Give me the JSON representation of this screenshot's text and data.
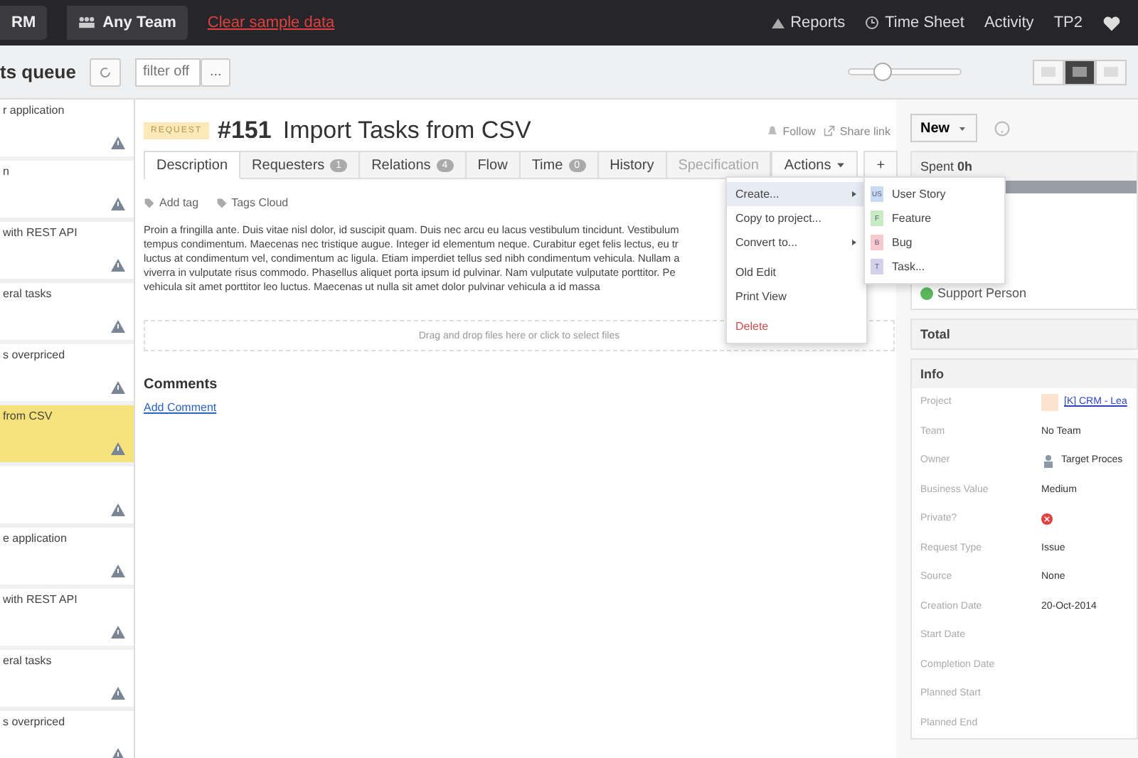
{
  "top_bar": {
    "project": "RM",
    "team": "Any Team",
    "clear_link": "Clear sample data",
    "nav": [
      {
        "kind": "reports",
        "label": "Reports"
      },
      {
        "kind": "clock",
        "label": "Time Sheet"
      },
      {
        "kind": "plain",
        "label": "Activity"
      },
      {
        "kind": "plain",
        "label": "TP2"
      }
    ]
  },
  "toolbar": {
    "title": "ts queue",
    "filter": {
      "placeholder": "filter off"
    },
    "more": "...",
    "zoom": {
      "level": 0.3
    },
    "views": [
      {
        "selected": false
      },
      {
        "selected": true
      },
      {
        "selected": false
      }
    ]
  },
  "queue": [
    {
      "title": "r application",
      "selected": false
    },
    {
      "title": "n",
      "selected": false
    },
    {
      "title": "with REST API",
      "selected": false
    },
    {
      "title": "eral tasks",
      "selected": false
    },
    {
      "title": "s overpriced",
      "selected": false
    },
    {
      "title": "from CSV",
      "selected": true
    },
    {
      "selected": false
    },
    {
      "title": "e application",
      "selected": false
    },
    {
      "title": "with REST API",
      "selected": false
    },
    {
      "title": "eral tasks",
      "selected": false
    },
    {
      "title": "s overpriced",
      "selected": false
    }
  ],
  "entity": {
    "type": "REQUEST",
    "id": "#151",
    "title": "Import Tasks from CSV",
    "follow": "Follow",
    "share": "Share link",
    "tabs": [
      {
        "label": "Description",
        "selected": true,
        "disabled": false
      },
      {
        "label": "Requesters",
        "count": "1",
        "selected": false,
        "disabled": false
      },
      {
        "label": "Relations",
        "count": "4",
        "selected": false,
        "disabled": false
      },
      {
        "label": "Flow",
        "selected": false,
        "disabled": false
      },
      {
        "label": "Time",
        "count": "0",
        "selected": false,
        "disabled": false
      },
      {
        "label": "History",
        "selected": false,
        "disabled": false
      },
      {
        "label": "Specification",
        "selected": false,
        "disabled": true
      }
    ],
    "actions": "Actions",
    "add": "+",
    "tags": [
      "Add tag",
      "Tags Cloud"
    ],
    "description": [
      "Proin a fringilla ante. Duis vitae nisl dolor, id suscipit quam. Duis nec arcu eu lacus vestibulum tincidunt. Vestibulum",
      "tempus condimentum. Maecenas nec tristique augue. Integer id elementum neque. Curabitur eget felis lectus, eu tr",
      "luctus at condimentum vel, condimentum ac ligula. Etiam imperdiet tellus sed nibh condimentum vehicula. Nullam a",
      "viverra in vulputate risus commodo. Phasellus aliquet porta ipsum id pulvinar. Nam vulputate vulputate porttitor. Pe",
      "vehicula sit amet porttitor leo luctus. Maecenas ut nulla sit amet dolor pulvinar vehicula a id massa"
    ],
    "dropzone": "Drag and drop files here or click to select files",
    "comments_title": "Comments",
    "add_comment": "Add Comment"
  },
  "actions_menu": [
    {
      "label": "Create...",
      "kind": "submenu",
      "selected": true
    },
    {
      "label": "Copy to project...",
      "kind": "item",
      "selected": false
    },
    {
      "label": "Convert to...",
      "kind": "submenu",
      "selected": false
    },
    {
      "label": "Old Edit",
      "kind": "item",
      "selected": false
    },
    {
      "label": "Print View",
      "kind": "item",
      "selected": false
    },
    {
      "label": "Delete",
      "kind": "danger",
      "selected": false
    }
  ],
  "create_menu": [
    {
      "badge": "US",
      "label": "User Story",
      "color": "#c9dbf2"
    },
    {
      "badge": "F",
      "label": "Feature",
      "color": "#c9ebc4"
    },
    {
      "badge": "B",
      "label": "Bug",
      "color": "#f7c9cc"
    },
    {
      "badge": "T",
      "label": "Task...",
      "color": "#d3d0ec"
    }
  ],
  "side": {
    "new_button": "New",
    "spent_label": "Spent",
    "spent_value": "0h",
    "support": "Support Person",
    "total": "Total",
    "info_title": "Info",
    "info": [
      {
        "label": "Project",
        "value": "[K] CRM - Lea",
        "kind": "link"
      },
      {
        "label": "Team",
        "value": "No Team",
        "kind": "text"
      },
      {
        "label": "Owner",
        "value": "Target Proces",
        "kind": "user"
      },
      {
        "label": "Business Value",
        "value": "Medium",
        "kind": "text"
      },
      {
        "label": "Private?",
        "kind": "no"
      },
      {
        "label": "Request Type",
        "value": "Issue",
        "kind": "text"
      },
      {
        "label": "Source",
        "value": "None",
        "kind": "text"
      },
      {
        "label": "Creation Date",
        "value": "20-Oct-2014",
        "kind": "text"
      },
      {
        "label": "Start Date",
        "kind": "empty"
      },
      {
        "label": "Completion Date",
        "kind": "empty"
      },
      {
        "label": "Planned Start",
        "kind": "empty"
      },
      {
        "label": "Planned End",
        "kind": "empty"
      }
    ]
  }
}
